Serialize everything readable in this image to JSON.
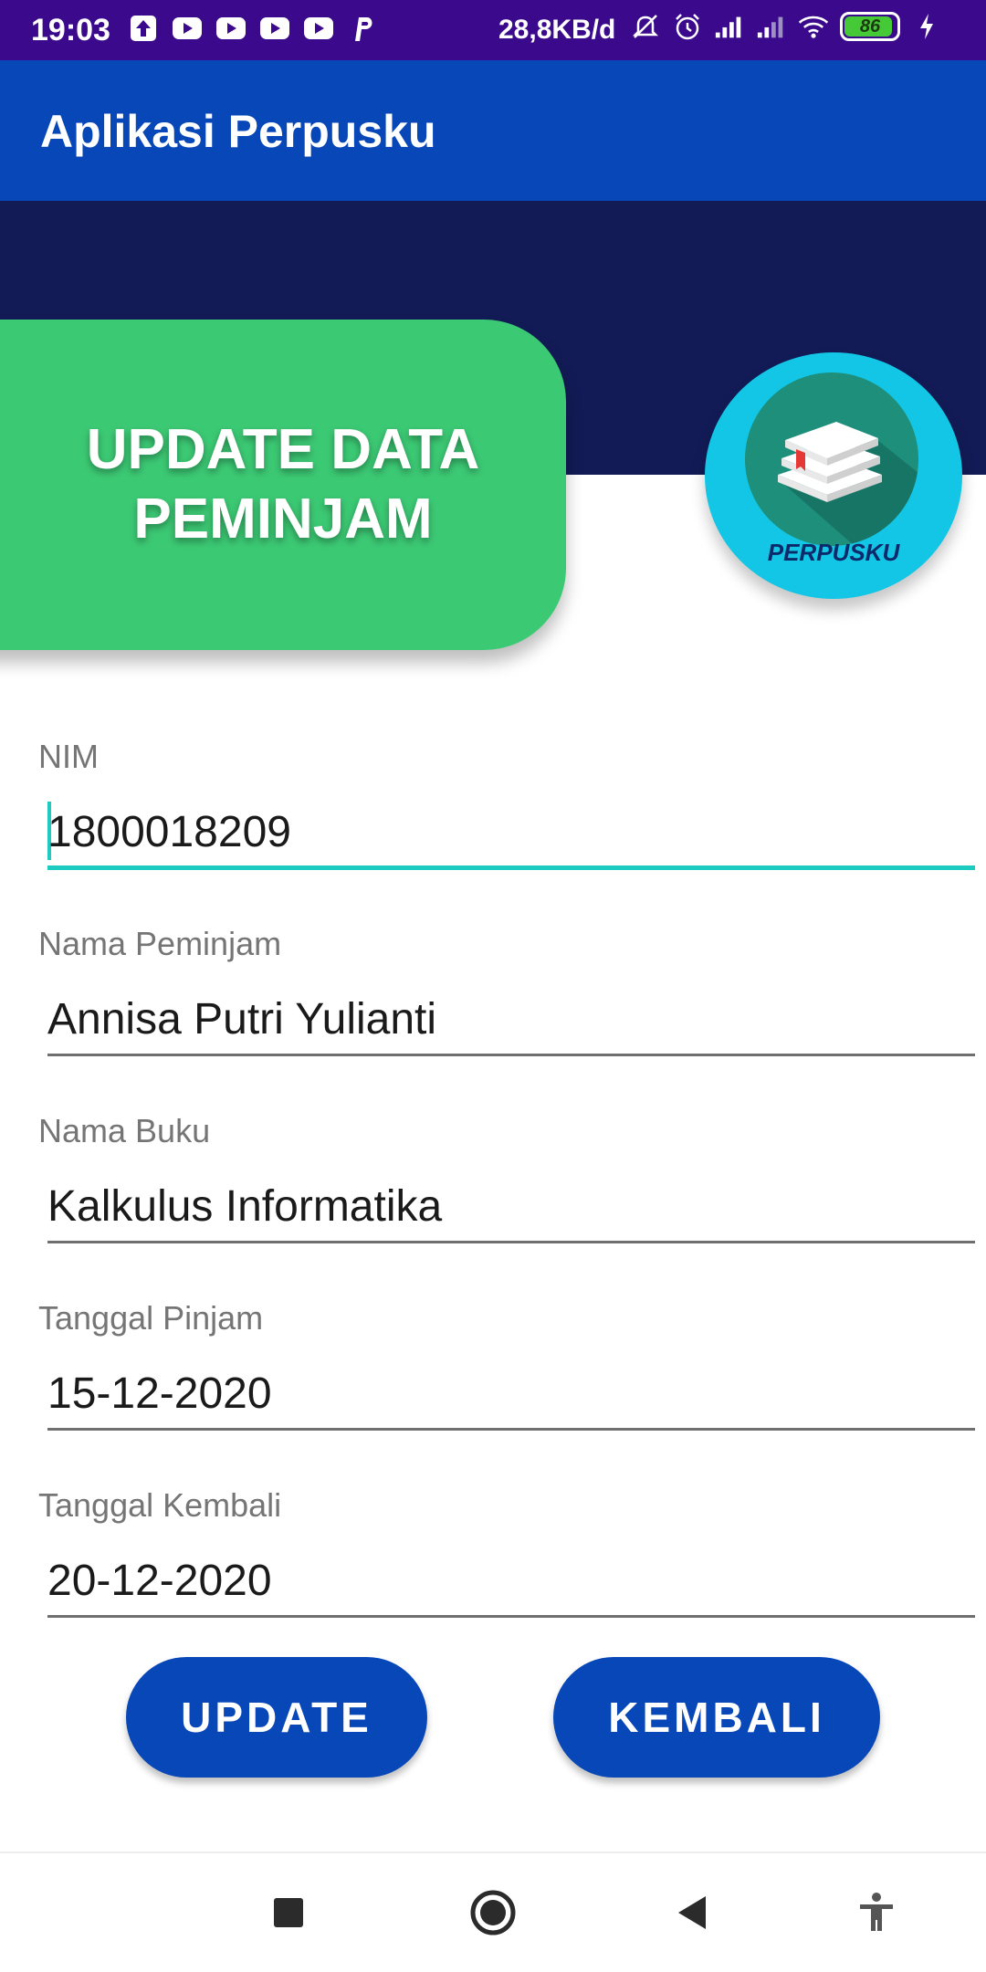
{
  "status_bar": {
    "time": "19:03",
    "net_speed": "28,8KB/d",
    "battery_level": "86",
    "battery_fraction": 0.86,
    "left_icons": [
      "upload-icon",
      "youtube-icon",
      "youtube-icon",
      "youtube-icon",
      "youtube-icon",
      "p-app-icon"
    ],
    "right_icons": [
      "mute-icon",
      "alarm-icon",
      "signal-icon",
      "signal-icon",
      "wifi-icon",
      "battery-icon",
      "charging-icon"
    ]
  },
  "app_bar": {
    "title": "Aplikasi Perpusku"
  },
  "header": {
    "title_line1": "UPDATE DATA",
    "title_line2": "PEMINJAM",
    "logo_text": "PERPUSKU"
  },
  "form": {
    "nim": {
      "label": "NIM",
      "value": "1800018209"
    },
    "nama_peminjam": {
      "label": "Nama Peminjam",
      "value": "Annisa Putri Yulianti"
    },
    "nama_buku": {
      "label": "Nama Buku",
      "value": "Kalkulus Informatika"
    },
    "tanggal_pinjam": {
      "label": "Tanggal Pinjam",
      "value": "15-12-2020"
    },
    "tanggal_kembali": {
      "label": "Tanggal Kembali",
      "value": "20-12-2020"
    }
  },
  "buttons": {
    "update_label": "UPDATE",
    "kembali_label": "KEMBALI"
  },
  "nav_bar": {
    "icons": [
      "recents-icon",
      "home-icon",
      "back-icon",
      "accessibility-icon"
    ]
  },
  "colors": {
    "status_bar": "#3b0a8c",
    "app_bar": "#0747b8",
    "banner_dark": "#121b55",
    "title_card": "#3cc974",
    "logo_circle": "#13c6e6",
    "focus_accent": "#1ecbc1",
    "button": "#0747b8"
  }
}
